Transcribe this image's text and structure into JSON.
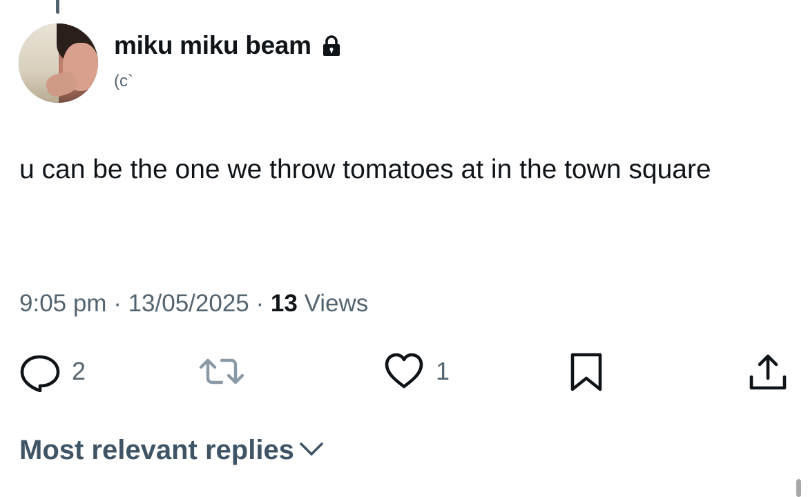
{
  "tweet": {
    "author": {
      "display_name": "miku miku beam",
      "handle": "(c`",
      "protected_icon": "lock-icon"
    },
    "text": "u can be the one we throw tomatoes at in the town square",
    "time": "9:05 pm",
    "separator": "·",
    "date": "13/05/2025",
    "views_count": "13",
    "views_label": "Views"
  },
  "actions": {
    "reply": {
      "icon": "reply-icon",
      "count": "2"
    },
    "repost": {
      "icon": "repost-icon",
      "count": ""
    },
    "like": {
      "icon": "heart-icon",
      "count": "1"
    },
    "bookmark": {
      "icon": "bookmark-icon"
    },
    "share": {
      "icon": "share-icon"
    }
  },
  "replies": {
    "sort_label": "Most relevant replies",
    "icon": "chevron-down-icon"
  },
  "colors": {
    "text_primary": "#0f1419",
    "text_secondary": "#536471",
    "background": "#ffffff"
  }
}
